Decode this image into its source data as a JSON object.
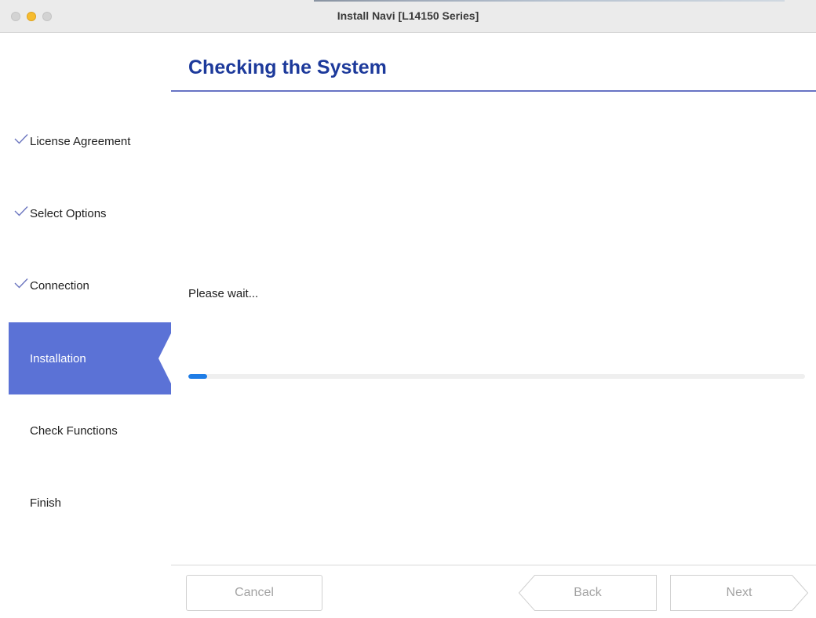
{
  "window": {
    "title": "Install Navi [L14150 Series]"
  },
  "sidebar": {
    "steps": [
      {
        "label": "License Agreement",
        "state": "done",
        "icon": "checkmark-icon"
      },
      {
        "label": "Select Options",
        "state": "done",
        "icon": "checkmark-icon"
      },
      {
        "label": "Connection",
        "state": "done",
        "icon": "checkmark-icon"
      },
      {
        "label": "Installation",
        "state": "active"
      },
      {
        "label": "Check Functions",
        "state": "pending"
      },
      {
        "label": "Finish",
        "state": "pending"
      }
    ]
  },
  "main": {
    "title": "Checking the System",
    "status": "Please wait...",
    "progress": 0.03
  },
  "footer": {
    "cancel_label": "Cancel",
    "back_label": "Back",
    "next_label": "Next"
  },
  "colors": {
    "accent_title": "#1d3a9b",
    "active_step_bg": "#5b72d6",
    "header_rule": "#6773c4",
    "progress_fill": "#1f7de6",
    "check_mark": "#6b75bf"
  }
}
